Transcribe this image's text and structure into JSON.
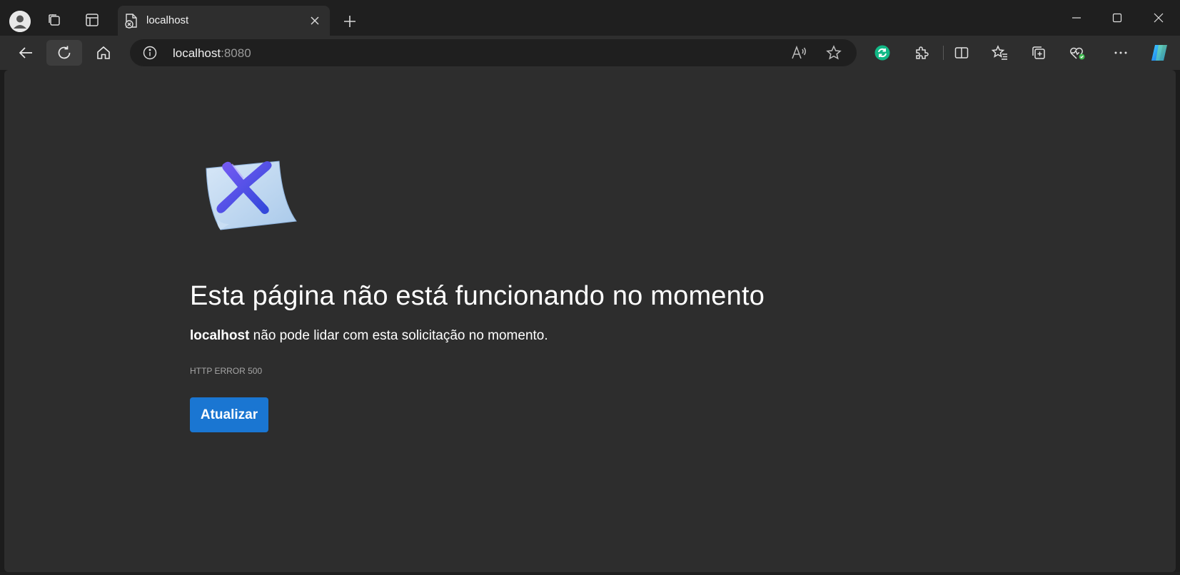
{
  "browser": {
    "tab": {
      "title": "localhost"
    },
    "address": {
      "host": "localhost",
      "port": ":8080"
    }
  },
  "page": {
    "title": "Esta página não está funcionando no momento",
    "desc_host": "localhost",
    "desc_rest": " não pode lidar com esta solicitação no momento.",
    "error_code": "HTTP ERROR 500",
    "reload_label": "Atualizar"
  },
  "colors": {
    "accent": "#1a76d2",
    "content_bg": "#2d2d2d",
    "chrome_bg": "#1f1f1f"
  },
  "icons": [
    "profile-icon",
    "workspaces-icon",
    "vertical-tabs-icon",
    "page-error-icon",
    "close-icon",
    "plus-icon",
    "minimize-icon",
    "maximize-icon",
    "close-window-icon",
    "back-icon",
    "refresh-icon",
    "home-icon",
    "info-icon",
    "read-aloud-icon",
    "favorite-star-icon",
    "extension-green-icon",
    "extensions-icon",
    "split-screen-icon",
    "favorites-icon",
    "collections-icon",
    "browser-essentials-icon",
    "more-icon",
    "copilot-icon"
  ]
}
